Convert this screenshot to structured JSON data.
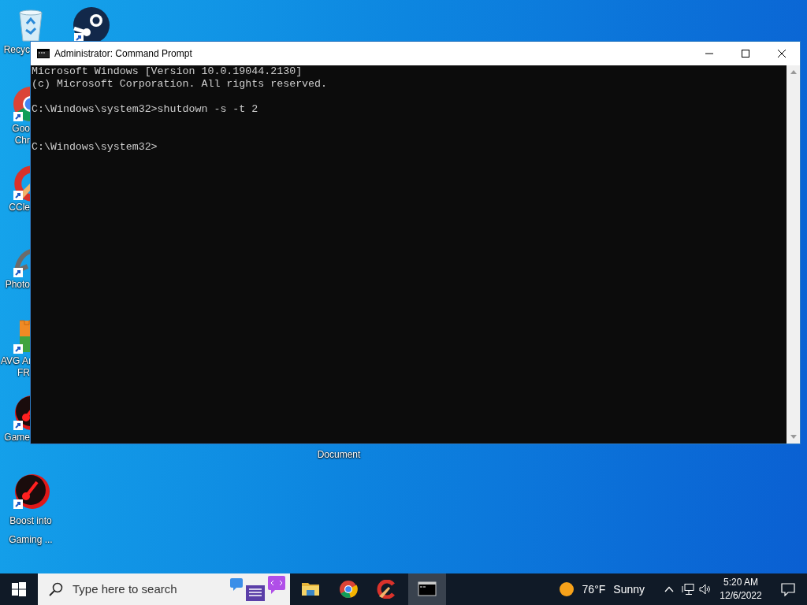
{
  "desktop": {
    "icons": [
      {
        "kind": "recycle-bin",
        "label": [
          "Recyc"
        ]
      },
      {
        "kind": "steam"
      },
      {
        "kind": "chrome",
        "label": [
          "Goo",
          "Chr"
        ]
      },
      {
        "kind": "ccleaner",
        "label": [
          "CCle"
        ]
      },
      {
        "kind": "photo-editor",
        "label": [
          "Photo"
        ]
      },
      {
        "kind": "antivirus",
        "label": [
          "AVG Ar",
          "FR"
        ]
      },
      {
        "kind": "game-booster",
        "label": [
          "Game"
        ]
      },
      {
        "kind": "game-booster",
        "label": [
          "Boost into",
          "Gaming ..."
        ]
      },
      {
        "kind": "text-document",
        "label": [
          "Document"
        ]
      }
    ]
  },
  "window": {
    "title": "Administrator: Command Prompt",
    "console": [
      {
        "kind": "output",
        "text": "Microsoft Windows [Version 10.0.19044.2130]"
      },
      {
        "kind": "output",
        "text": "(c) Microsoft Corporation. All rights reserved."
      },
      {
        "kind": "command",
        "text": "C:\\Windows\\system32>shutdown -s -t 2"
      },
      {
        "kind": "prompt",
        "text": "C:\\Windows\\system32>"
      }
    ]
  },
  "taskbar": {
    "search": {
      "placeholder": "Type here to search"
    },
    "apps": [
      {
        "kind": "file-explorer",
        "selected": false
      },
      {
        "kind": "chrome",
        "selected": false
      },
      {
        "kind": "ccleaner",
        "selected": false
      },
      {
        "kind": "command-prompt",
        "selected": true
      }
    ],
    "weather": {
      "temperature": "76°F",
      "condition": "Sunny"
    },
    "clock": {
      "time": "5:20 AM",
      "date": "12/6/2022"
    }
  }
}
